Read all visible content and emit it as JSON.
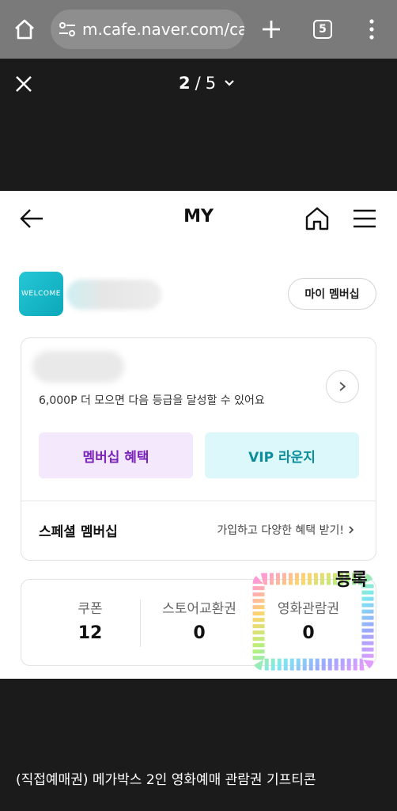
{
  "browser": {
    "url": "m.cafe.naver.com/ca",
    "tab_count": "5"
  },
  "viewer": {
    "current_page": "2",
    "separator": "/",
    "total_pages": "5"
  },
  "screen": {
    "title": "MY",
    "profile": {
      "badge": "WELCOME",
      "my_membership_button": "마이 멤버십"
    },
    "grade_card": {
      "progress_text": "6,000P 더 모으면 다음 등급을 달성할 수 있어요",
      "benefit_button": "멤버십 혜택",
      "vip_button": "VIP 라운지",
      "special_title": "스페셜 멤버십",
      "special_link": "가입하고 다양한 혜택 받기!"
    },
    "stats": [
      {
        "label": "쿠폰",
        "value": "12"
      },
      {
        "label": "스토어교환권",
        "value": "0"
      },
      {
        "label": "영화관람권",
        "value": "0"
      }
    ],
    "annotation": "등록"
  },
  "caption": "(직접예매권) 메가박스 2인 영화예매 관람권 기프티콘"
}
